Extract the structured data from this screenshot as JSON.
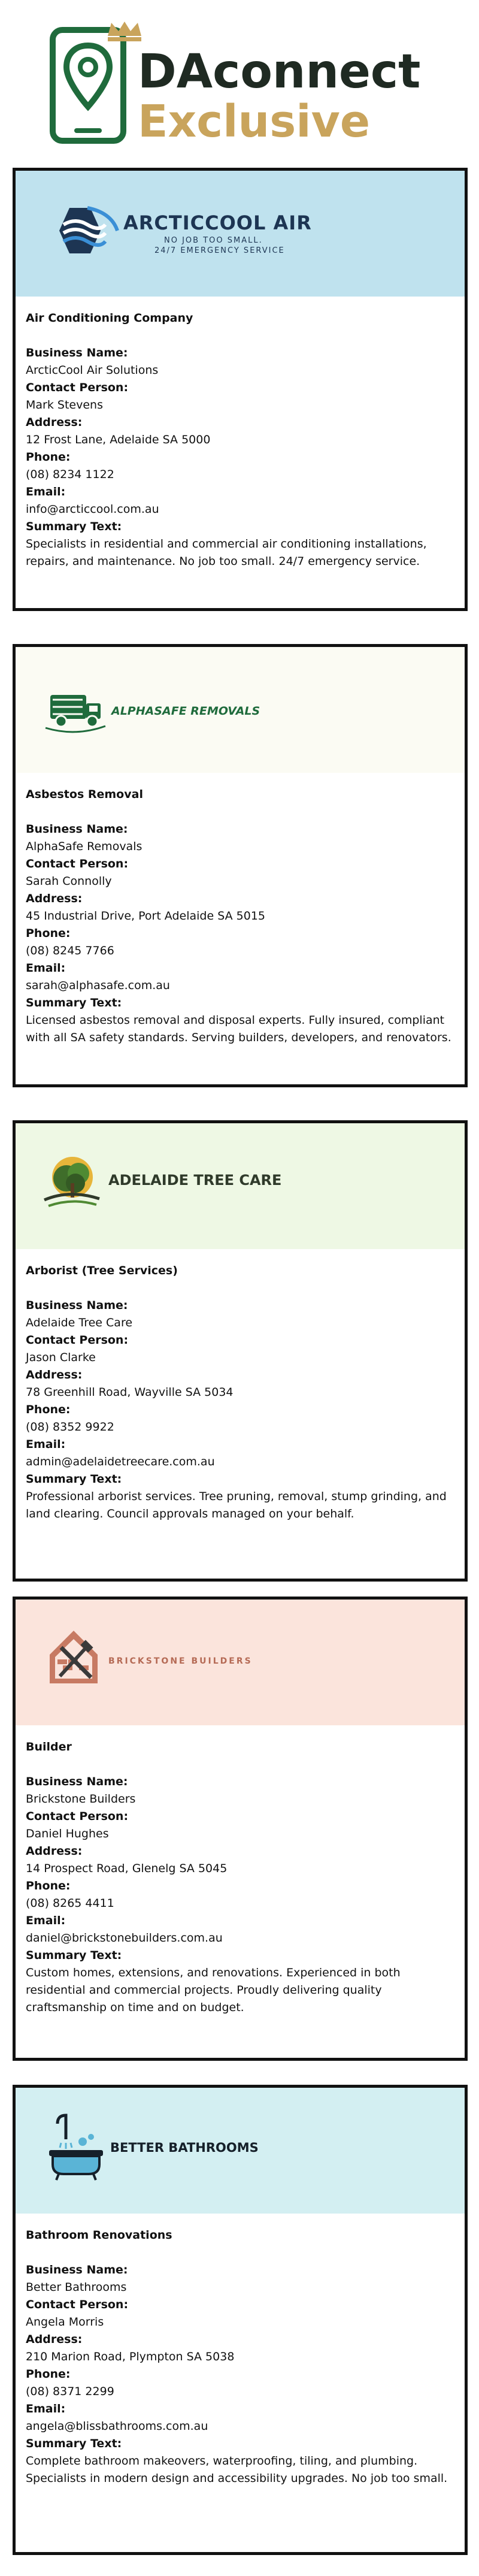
{
  "brand": {
    "name_line1": "DAconnect",
    "name_line2": "Exclusive",
    "colors": {
      "dark": "#1f2a22",
      "green": "#1f6b3c",
      "gold": "#c9a45c"
    }
  },
  "labels": {
    "business_name": "Business Name:",
    "contact_person": "Contact Person:",
    "address": "Address:",
    "phone": "Phone:",
    "email": "Email:",
    "summary": "Summary Text:"
  },
  "listings": [
    {
      "banner": {
        "bg": "#bfe2ee",
        "logo_text": "ARCTICCOOL AIR",
        "tagline1": "NO JOB TOO SMALL.",
        "tagline2": "24/7 EMERGENCY SERVICE",
        "text_color": "#1d3553"
      },
      "category": "Air Conditioning Company",
      "business_name": "ArcticCool Air Solutions",
      "contact_person": "Mark Stevens",
      "address": "12 Frost Lane, Adelaide SA 5000",
      "phone": "(08) 8234 1122",
      "email": "info@arcticcool.com.au",
      "summary_lines": [
        "Specialists in residential and commercial air conditioning installations,",
        "repairs, and maintenance. No job too small. 24/7 emergency service."
      ]
    },
    {
      "banner": {
        "bg": "#fbfbf3",
        "logo_text": "ALPHASAFE REMOVALS",
        "text_color": "#1f6b3c"
      },
      "category": "Asbestos Removal",
      "business_name": "AlphaSafe Removals",
      "contact_person": "Sarah Connolly",
      "address": "45 Industrial Drive, Port Adelaide SA 5015",
      "phone": "(08) 8245 7766",
      "email": "sarah@alphasafe.com.au",
      "summary_lines": [
        "Licensed asbestos removal and disposal experts. Fully insured, compliant",
        "with all SA safety standards. Serving builders, developers, and renovators."
      ]
    },
    {
      "banner": {
        "bg": "#eef8e4",
        "logo_text": "ADELAIDE TREE CARE",
        "text_color": "#2f3a2a"
      },
      "category": "Arborist (Tree Services)",
      "business_name": "Adelaide Tree Care",
      "contact_person": "Jason Clarke",
      "address": "78 Greenhill Road, Wayville SA 5034",
      "phone": "(08) 8352 9922",
      "email": "admin@adelaidetreecare.com.au",
      "summary_lines": [
        "Professional arborist services. Tree pruning, removal, stump grinding, and",
        "land clearing. Council approvals managed on your behalf."
      ]
    },
    {
      "banner": {
        "bg": "#fbe4dc",
        "logo_text": "BRICKSTONE BUILDERS",
        "text_color": "#b56a55"
      },
      "category": "Builder",
      "business_name": "Brickstone Builders",
      "contact_person": "Daniel Hughes",
      "address": "14 Prospect Road, Glenelg SA 5045",
      "phone": "(08) 8265 4411",
      "email": "daniel@brickstonebuilders.com.au",
      "summary_lines": [
        "Custom homes, extensions, and renovations. Experienced in both",
        "residential and commercial projects. Proudly delivering quality",
        "craftsmanship on time and on budget."
      ]
    },
    {
      "banner": {
        "bg": "#d3eff2",
        "logo_text": "BETTER BATHROOMS",
        "text_color": "#16202a"
      },
      "category": "Bathroom Renovations",
      "business_name": "Better Bathrooms",
      "contact_person": "Angela Morris",
      "address": "210 Marion Road, Plympton SA 5038",
      "phone": "(08) 8371 2299",
      "email": "angela@blissbathrooms.com.au",
      "summary_lines": [
        "Complete bathroom makeovers, waterproofing, tiling, and plumbing.",
        "Specialists in modern design and accessibility upgrades. No job too small."
      ]
    }
  ]
}
